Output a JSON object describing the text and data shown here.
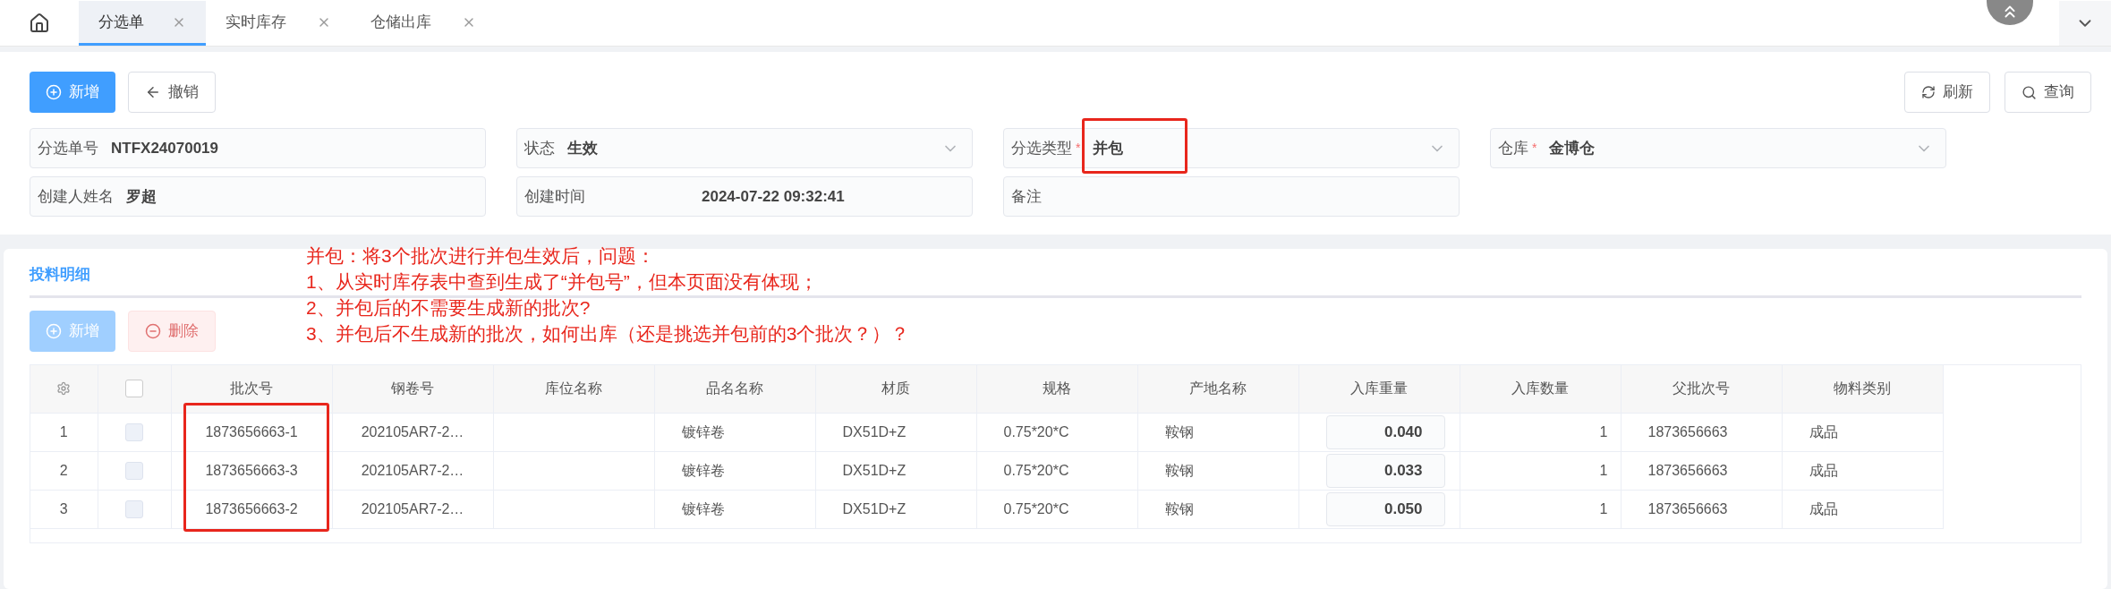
{
  "tabs": [
    {
      "label": "分选单",
      "selected": true
    },
    {
      "label": "实时库存",
      "selected": false
    },
    {
      "label": "仓储出库",
      "selected": false
    }
  ],
  "toolbar": {
    "buttons": [
      {
        "label": "新增",
        "kind": "primary"
      },
      {
        "label": "撤销",
        "kind": "back"
      }
    ],
    "right_buttons": [
      {
        "label": "刷新",
        "kind": "refresh"
      },
      {
        "label": "查询",
        "kind": "search"
      }
    ]
  },
  "form": {
    "rows": [
      [
        {
          "label": "分选单号",
          "value": "NTFX24070019",
          "kind": "text"
        },
        {
          "label": "状态",
          "value": "生效",
          "kind": "select"
        },
        {
          "label": "分选类型",
          "required_mark": "*",
          "value": "并包",
          "kind": "select",
          "highlighted": true
        },
        {
          "label": "仓库",
          "required_mark": "*",
          "value": "金博仓",
          "kind": "select"
        }
      ],
      [
        {
          "label": "创建人姓名",
          "value": "罗超",
          "kind": "text"
        },
        {
          "label": "创建时间",
          "value": "2024-07-22 09:32:41",
          "kind": "time"
        },
        {
          "label": "备注",
          "kind": "text"
        }
      ]
    ]
  },
  "detail": {
    "title": "投料明细",
    "buttons": [
      {
        "label": "新增",
        "kind": "primary",
        "disabled": true
      },
      {
        "label": "删除",
        "kind": "danger",
        "disabled": true
      }
    ],
    "annotation": [
      "并包：将3个批次进行并包生效后，问题：",
      "1、从实时库存表中查到生成了“并包号”，但本页面没有体现；",
      "2、并包后的不需要生成新的批次?",
      "3、并包后不生成新的批次，如何出库（还是挑选并包前的3个批次？）？"
    ],
    "table": {
      "columns": [
        "批次号",
        "钢卷号",
        "库位名称",
        "品名名称",
        "材质",
        "规格",
        "产地名称",
        "入库重量",
        "入库数量",
        "父批次号",
        "物料类别"
      ],
      "header_checked": false,
      "batch_highlighted": true,
      "rows": [
        {
          "index": "1",
          "checked": false,
          "cells": [
            "1873656663-1",
            "202105AR7-2…",
            "",
            "镀锌卷",
            "DX51D+Z",
            "0.75*20*C",
            "鞍钢",
            "0.040",
            "1",
            "1873656663",
            "成品"
          ]
        },
        {
          "index": "2",
          "checked": false,
          "cells": [
            "1873656663-3",
            "202105AR7-2…",
            "",
            "镀锌卷",
            "DX51D+Z",
            "0.75*20*C",
            "鞍钢",
            "0.033",
            "1",
            "1873656663",
            "成品"
          ]
        },
        {
          "index": "3",
          "checked": false,
          "cells": [
            "1873656663-2",
            "202105AR7-2…",
            "",
            "镀锌卷",
            "DX51D+Z",
            "0.75*20*C",
            "鞍钢",
            "0.050",
            "1",
            "1873656663",
            "成品"
          ]
        }
      ]
    }
  }
}
